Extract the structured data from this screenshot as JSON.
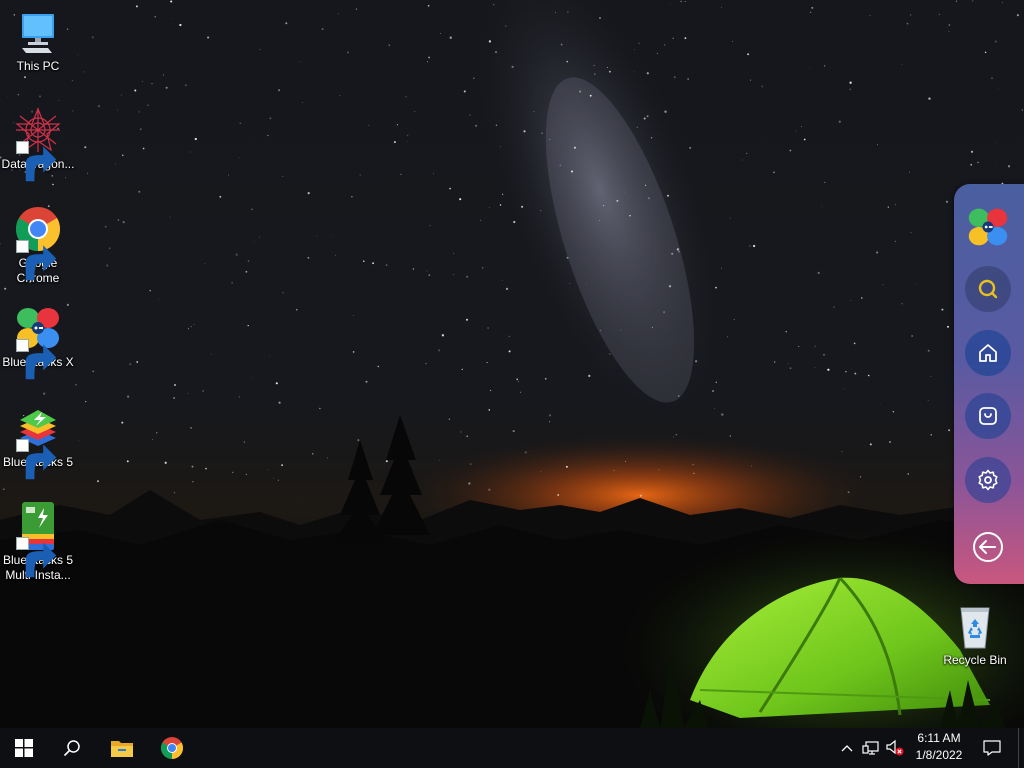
{
  "desktop": {
    "icons": [
      {
        "label": "This PC",
        "icon": "computer-icon"
      },
      {
        "label": "DataWagon...",
        "icon": "datawagon-icon"
      },
      {
        "label": "Google Chrome",
        "icon": "chrome-icon"
      },
      {
        "label": "BlueStacks X",
        "icon": "bluestacks-x-icon"
      },
      {
        "label": "BlueStacks 5",
        "icon": "bluestacks-5-icon"
      },
      {
        "label": "BlueStacks 5 Multi-Insta...",
        "icon": "bluestacks-multi-instance-icon"
      },
      {
        "label": "Recycle Bin",
        "icon": "recycle-bin-icon"
      }
    ]
  },
  "side_panel": {
    "buttons": [
      "bluestacks-x-logo-icon",
      "search-icon",
      "home-icon",
      "store-bag-icon",
      "settings-gear-icon",
      "back-arrow-icon"
    ],
    "search_color": "#e8c11c"
  },
  "taskbar": {
    "pinned": [
      "windows-start-icon",
      "search-icon",
      "file-explorer-icon",
      "chrome-icon"
    ],
    "tray": [
      "chevron-up-icon",
      "network-icon",
      "volume-muted-icon",
      "notification-icon"
    ],
    "time": "6:11 AM",
    "date": "1/8/2022"
  }
}
